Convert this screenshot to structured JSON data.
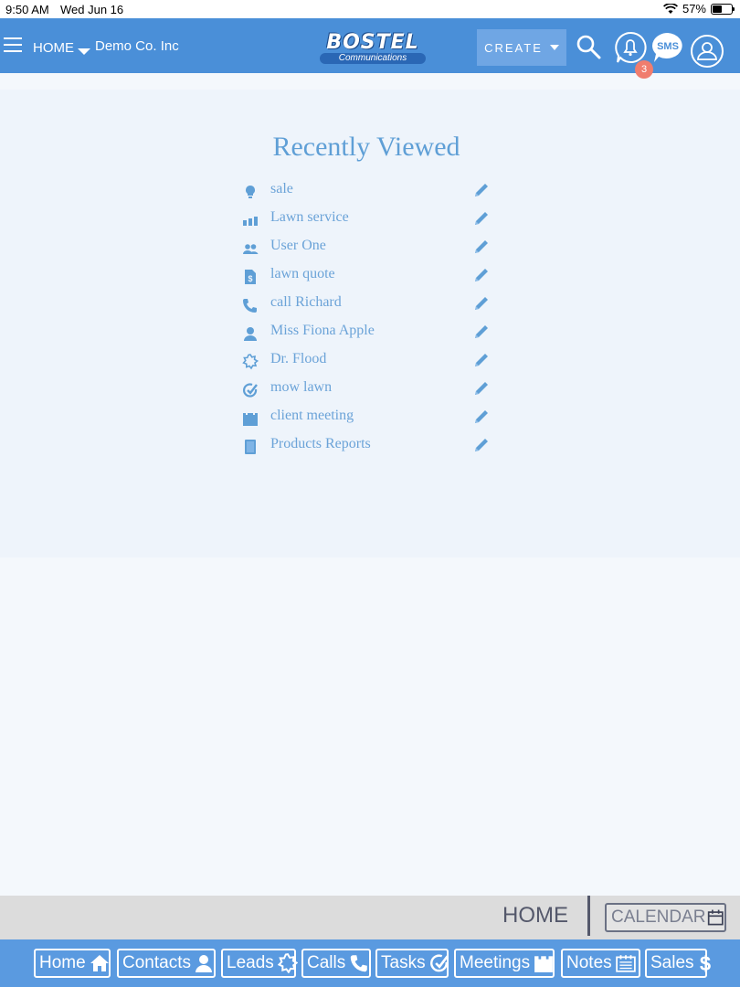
{
  "status_bar": {
    "time": "9:50 AM",
    "date": "Wed Jun 16",
    "battery": "57%"
  },
  "header": {
    "nav_label": "HOME",
    "company": "Demo Co. Inc",
    "logo_text": "BOSTEL",
    "logo_sub": "Communications",
    "create_label": "CREATE",
    "notification_count": "3",
    "sms_label": "SMS"
  },
  "recently_viewed": {
    "title": "Recently Viewed",
    "items": [
      {
        "label": "sale",
        "icon": "lightbulb-icon"
      },
      {
        "label": "Lawn service",
        "icon": "bar-chart-icon"
      },
      {
        "label": "User One",
        "icon": "users-icon"
      },
      {
        "label": "lawn quote",
        "icon": "quote-document-icon"
      },
      {
        "label": "call Richard",
        "icon": "phone-icon"
      },
      {
        "label": "Miss Fiona Apple",
        "icon": "person-icon"
      },
      {
        "label": "Dr. Flood",
        "icon": "badge-icon"
      },
      {
        "label": "mow lawn",
        "icon": "task-check-icon"
      },
      {
        "label": "client meeting",
        "icon": "meeting-calendar-icon"
      },
      {
        "label": "Products Reports",
        "icon": "report-icon"
      }
    ]
  },
  "breadcrumb": {
    "current": "HOME",
    "calendar_label": "CALENDAR"
  },
  "bottom_nav": [
    {
      "label": "Home",
      "icon": "house-icon"
    },
    {
      "label": "Contacts",
      "icon": "person-icon"
    },
    {
      "label": "Leads",
      "icon": "badge-icon"
    },
    {
      "label": "Calls",
      "icon": "phone-icon"
    },
    {
      "label": "Tasks",
      "icon": "task-check-icon"
    },
    {
      "label": "Meetings",
      "icon": "meeting-calendar-icon"
    },
    {
      "label": "Notes",
      "icon": "notes-icon"
    },
    {
      "label": "Sales",
      "icon": "dollar-icon"
    }
  ],
  "colors": {
    "header": "#4a8fd8",
    "accent": "#5f9fd6",
    "badge": "#f07d6e",
    "nav": "#5a9ae0"
  }
}
